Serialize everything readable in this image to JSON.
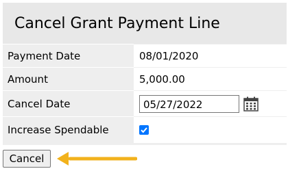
{
  "dialog": {
    "title": "Cancel Grant Payment Line",
    "fields": {
      "payment_date": {
        "label": "Payment Date",
        "value": "08/01/2020"
      },
      "amount": {
        "label": "Amount",
        "value": "5,000.00"
      },
      "cancel_date": {
        "label": "Cancel Date",
        "value": "05/27/2022"
      },
      "increase_spendable": {
        "label": "Increase Spendable",
        "checked": true
      }
    },
    "cancel_label": "Cancel"
  },
  "colors": {
    "panel_bg": "#eeeeee",
    "checkbox_accent": "#0075ff",
    "arrow": "#f2b21c"
  },
  "icons": [
    "calendar-icon",
    "checkmark-icon",
    "arrow-left-icon"
  ]
}
